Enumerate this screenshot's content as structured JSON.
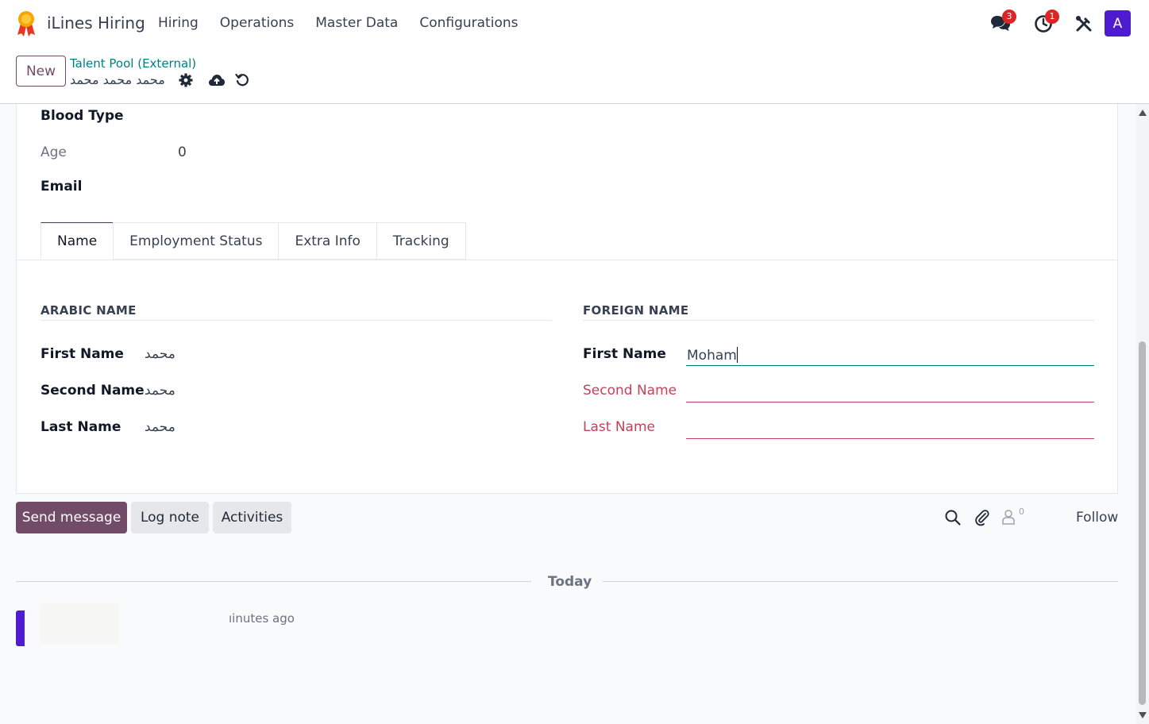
{
  "navbar": {
    "app_name": "iLines Hiring",
    "menu": [
      "Hiring",
      "Operations",
      "Master Data",
      "Configurations"
    ],
    "messages_badge": "3",
    "activities_badge": "1",
    "avatar_letter": "A"
  },
  "control": {
    "new_label": "New",
    "breadcrumb": "Talent Pool (External)",
    "record_name": "محمد محمد محمد"
  },
  "form": {
    "blood_type_label": "Blood Type",
    "age_label": "Age",
    "age_value": "0",
    "email_label": "Email",
    "tabs": [
      "Name",
      "Employment Status",
      "Extra Info",
      "Tracking"
    ],
    "arabic_name": {
      "title": "ARABIC NAME",
      "first_label": "First Name",
      "first_value": "محمد",
      "second_label": "Second Name",
      "second_value": "محمد",
      "last_label": "Last Name",
      "last_value": "محمد"
    },
    "foreign_name": {
      "title": "FOREIGN NAME",
      "first_label": "First Name",
      "first_value": "Moham",
      "second_label": "Second Name",
      "second_value": "",
      "last_label": "Last Name",
      "last_value": ""
    }
  },
  "chatter": {
    "send_message": "Send message",
    "log_note": "Log note",
    "activities": "Activities",
    "followers_count": "0",
    "follow": "Follow",
    "today": "Today",
    "message_time": "ıinutes ago"
  },
  "colors": {
    "brand": "#714b67",
    "breadcrumb": "#017e84",
    "required": "#c5405a",
    "avatar": "#4f1bd1",
    "badge": "#dc2626"
  }
}
